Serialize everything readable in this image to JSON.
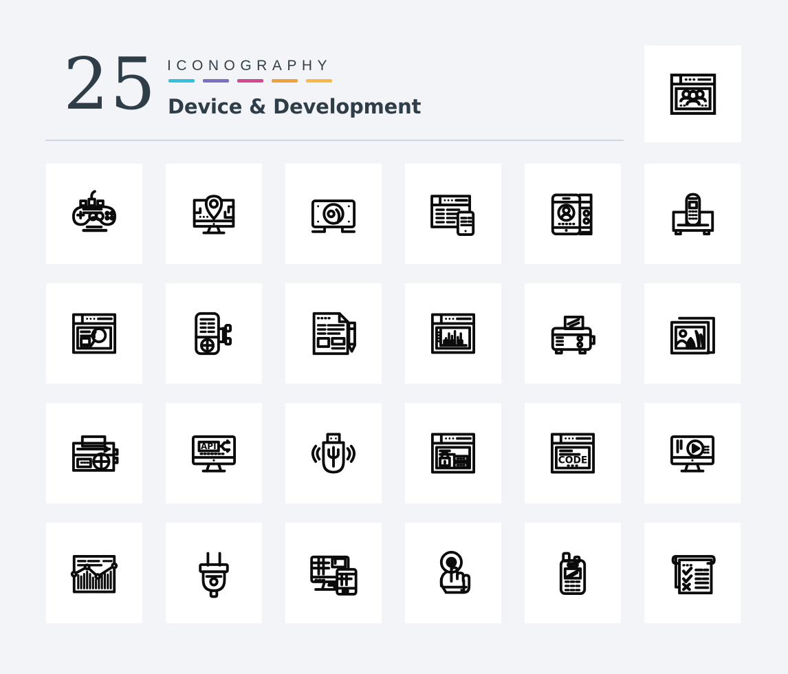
{
  "header": {
    "count": "25",
    "eyebrow": "ICONOGRAPHY",
    "title": "Device & Development",
    "swatch_colors": [
      "#35c0dd",
      "#7b6fc4",
      "#cf4a93",
      "#f1a13c",
      "#f4bc46"
    ]
  },
  "featured": {
    "icon": "browser-team-icon",
    "label": "Web Team"
  },
  "grid": {
    "columns": 6,
    "rows": 4,
    "icons": [
      {
        "icon": "gamepad-icon",
        "label": "Game Controller"
      },
      {
        "icon": "monitor-location-icon",
        "label": "Local Seo"
      },
      {
        "icon": "hard-disk-icon",
        "label": "Hard Disk"
      },
      {
        "icon": "responsive-browser-mobile-icon",
        "label": "Responsive"
      },
      {
        "icon": "mobile-user-profile-icon",
        "label": "Mobile Profile"
      },
      {
        "icon": "cordless-phone-icon",
        "label": "Telephone"
      },
      {
        "icon": "browser-search-icon",
        "label": "Web Search"
      },
      {
        "icon": "mp3-player-icon",
        "label": "Music Player"
      },
      {
        "icon": "document-pencil-icon",
        "label": "Content Writing"
      },
      {
        "icon": "browser-bar-chart-icon",
        "label": "Web Analytics"
      },
      {
        "icon": "toaster-icon",
        "label": "Toaster"
      },
      {
        "icon": "photo-gallery-icon",
        "label": "Gallery"
      },
      {
        "icon": "radio-icon",
        "label": "Radio"
      },
      {
        "icon": "monitor-api-icon",
        "label": "Api"
      },
      {
        "icon": "usb-drive-icon",
        "label": "Usb"
      },
      {
        "icon": "browser-lock-icon",
        "label": "Secure Login"
      },
      {
        "icon": "browser-code-icon",
        "label": "Coding"
      },
      {
        "icon": "monitor-play-icon",
        "label": "Video Player"
      },
      {
        "icon": "browser-analytics-graph-icon",
        "label": "Statistics"
      },
      {
        "icon": "electric-plug-icon",
        "label": "Plug"
      },
      {
        "icon": "devices-responsive-icon",
        "label": "Devices"
      },
      {
        "icon": "touch-hand-icon",
        "label": "Touch"
      },
      {
        "icon": "walkie-talkie-icon",
        "label": "Walkie Talkie"
      },
      {
        "icon": "checklist-icon",
        "label": "Checklist"
      }
    ]
  }
}
